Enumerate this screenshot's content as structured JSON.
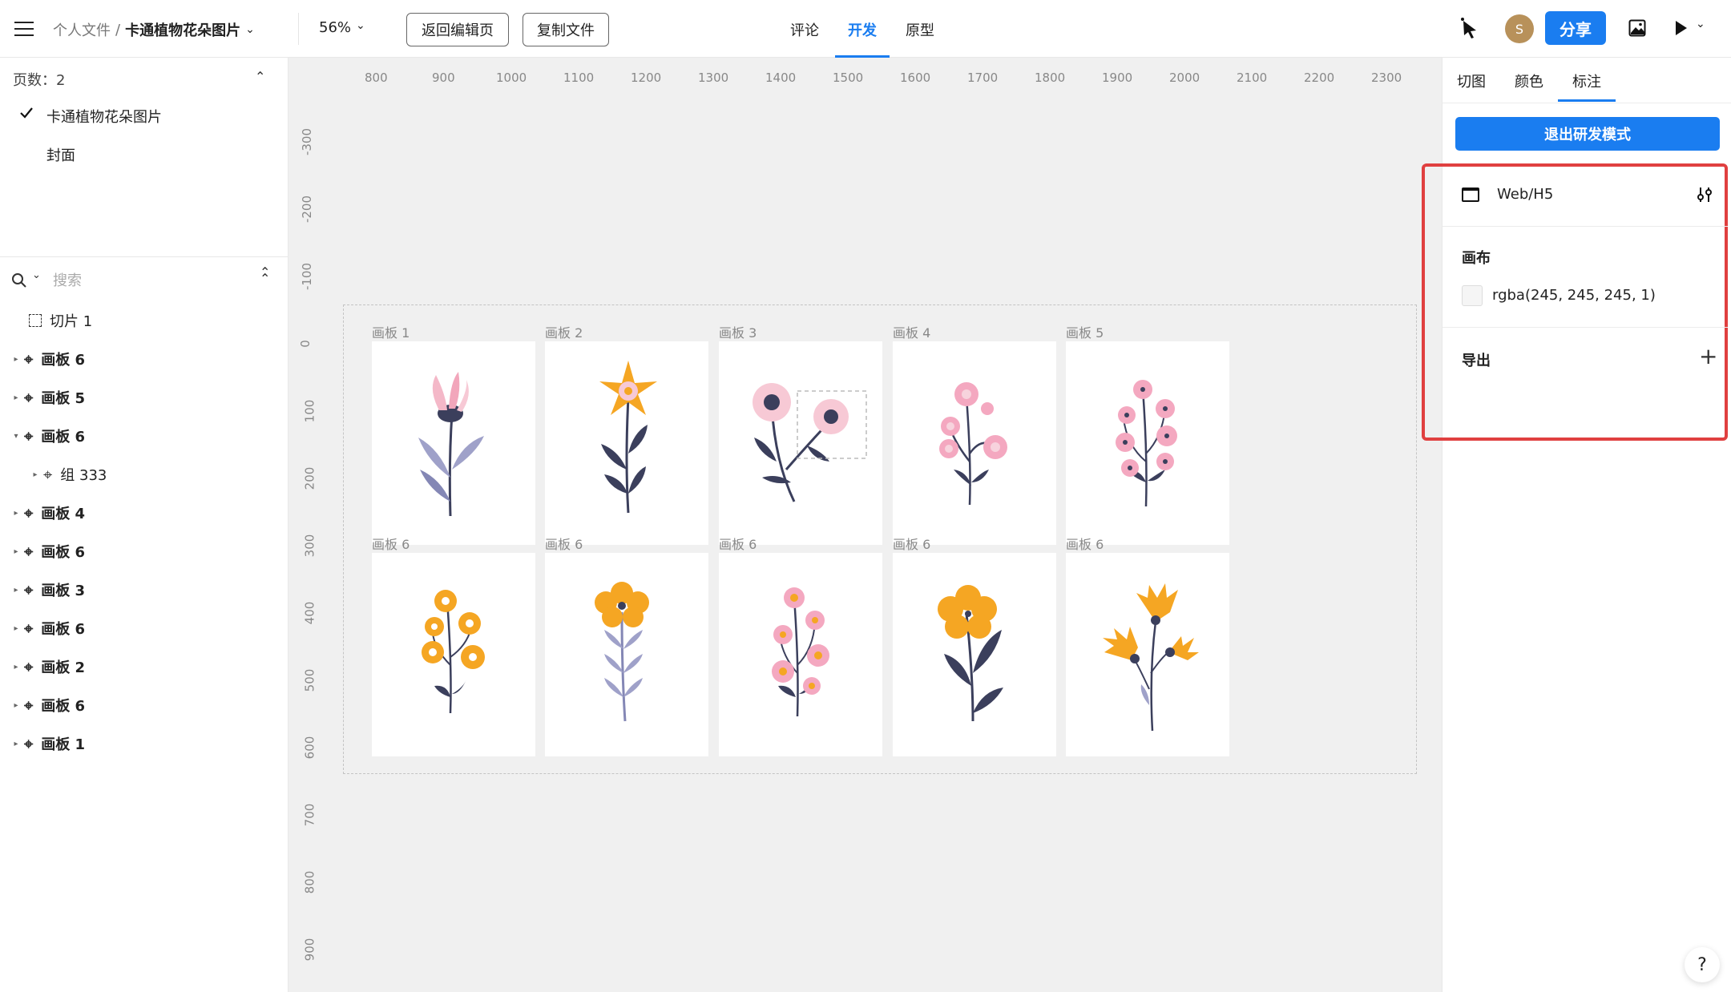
{
  "topbar": {
    "breadcrumb_parent": "个人文件",
    "breadcrumb_sep": "/",
    "file_title": "卡通植物花朵图片",
    "zoom": "56%",
    "back_button": "返回编辑页",
    "copy_button": "复制文件",
    "tabs": [
      "评论",
      "开发",
      "原型"
    ],
    "active_tab": "开发",
    "avatar_initial": "S",
    "share_button": "分享"
  },
  "left": {
    "pages_label": "页数：2",
    "pages": [
      "卡通植物花朵图片",
      "封面"
    ],
    "search_placeholder": "搜索",
    "layers": [
      {
        "name": "切片 1",
        "bold": false
      },
      {
        "name": "画板 6",
        "bold": true
      },
      {
        "name": "画板 5",
        "bold": true
      },
      {
        "name": "画板 6",
        "bold": true
      },
      {
        "name": "组 333",
        "bold": false
      },
      {
        "name": "画板 4",
        "bold": true
      },
      {
        "name": "画板 6",
        "bold": true
      },
      {
        "name": "画板 3",
        "bold": true
      },
      {
        "name": "画板 6",
        "bold": true
      },
      {
        "name": "画板 2",
        "bold": true
      },
      {
        "name": "画板 6",
        "bold": true
      },
      {
        "name": "画板 1",
        "bold": true
      }
    ]
  },
  "canvas": {
    "ruler_x": [
      "800",
      "900",
      "1000",
      "1100",
      "1200",
      "1300",
      "1400",
      "1500",
      "1600",
      "1700",
      "1800",
      "1900",
      "2000",
      "2100",
      "2200",
      "2300"
    ],
    "ruler_y": [
      "-300",
      "-200",
      "-100",
      "0",
      "100",
      "200",
      "300",
      "400",
      "500",
      "600",
      "700",
      "800",
      "900"
    ],
    "boards_top": [
      "画板 1",
      "画板 2",
      "画板 3",
      "画板 4",
      "画板 5"
    ],
    "boards_bottom": [
      "画板 6",
      "画板 6",
      "画板 6",
      "画板 6",
      "画板 6"
    ]
  },
  "right": {
    "tabs": [
      "切图",
      "颜色",
      "标注"
    ],
    "active_tab": "标注",
    "exit_button": "退出研发模式",
    "platform": "Web/H5",
    "canvas_section": "画布",
    "canvas_color": "rgba(245, 245, 245, 1)",
    "export_section": "导出",
    "help": "?"
  },
  "colors": {
    "accent": "#1a7df0",
    "highlight": "#e04040"
  }
}
